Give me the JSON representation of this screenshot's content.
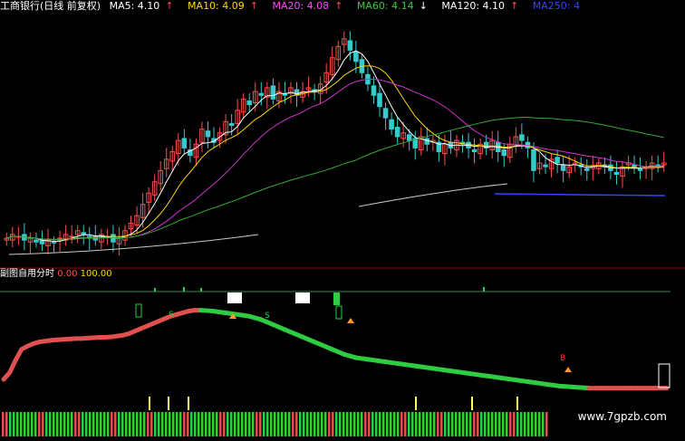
{
  "header": {
    "stock_label": "工商银行(日线 前复权)",
    "ma_items": [
      {
        "label": "MA5: 4.10",
        "arrow": "↑",
        "color": "#ffffff"
      },
      {
        "label": "MA10: 4.09",
        "arrow": "↑",
        "color": "#ffd700"
      },
      {
        "label": "MA20: 4.08",
        "arrow": "↑",
        "color": "#ff44ff"
      },
      {
        "label": "MA60: 4.14",
        "arrow": "↓",
        "color": "#33cc33"
      },
      {
        "label": "MA120: 4.10",
        "arrow": "↑",
        "color": "#ffffff"
      },
      {
        "label": "MA250: 4",
        "arrow": "",
        "color": "#3344ff"
      }
    ]
  },
  "indicator": {
    "name": "副图自用分时",
    "params": "0.00",
    "value": "100.00",
    "signal_labels": [
      "S",
      "S",
      "B"
    ]
  },
  "watermark": "www.7gpzb.com",
  "colors": {
    "up": "#ff4d4d",
    "down": "#33cccc",
    "green": "#2ecc40",
    "red": "#e05050"
  },
  "chart_data": {
    "type": "candlestick",
    "main": {
      "closes": [
        3.84,
        3.86,
        3.85,
        3.83,
        3.84,
        3.82,
        3.81,
        3.83,
        3.82,
        3.84,
        3.86,
        3.85,
        3.88,
        3.86,
        3.84,
        3.83,
        3.86,
        3.85,
        3.82,
        3.84,
        3.88,
        3.92,
        3.96,
        4.02,
        4.08,
        4.14,
        4.2,
        4.26,
        4.3,
        4.36,
        4.32,
        4.28,
        4.34,
        4.42,
        4.38,
        4.35,
        4.4,
        4.46,
        4.44,
        4.52,
        4.58,
        4.55,
        4.62,
        4.6,
        4.64,
        4.58,
        4.62,
        4.6,
        4.64,
        4.6,
        4.62,
        4.64,
        4.62,
        4.66,
        4.72,
        4.8,
        4.86,
        4.9,
        4.84,
        4.78,
        4.72,
        4.66,
        4.6,
        4.54,
        4.48,
        4.42,
        4.38,
        4.4,
        4.36,
        4.32,
        4.38,
        4.34,
        4.36,
        4.3,
        4.34,
        4.32,
        4.36,
        4.34,
        4.32,
        4.3,
        4.34,
        4.32,
        4.36,
        4.3,
        4.28,
        4.34,
        4.38,
        4.36,
        4.32,
        4.2,
        4.24,
        4.22,
        4.26,
        4.24,
        4.2,
        4.22,
        4.24,
        4.22,
        4.2,
        4.22,
        4.24,
        4.22,
        4.2,
        4.18,
        4.22,
        4.24,
        4.22,
        4.2,
        4.22,
        4.24,
        4.22,
        4.24
      ],
      "ylim": [
        3.72,
        5.02
      ]
    },
    "indicator": {
      "red_line": [
        24,
        40,
        70,
        96,
        104,
        110,
        114,
        116,
        118,
        119,
        120,
        121,
        122,
        122,
        123,
        124,
        125,
        125,
        126,
        128,
        130,
        134,
        140,
        146,
        152,
        158,
        164,
        170,
        176,
        180,
        184,
        188,
        190,
        190,
        189,
        188,
        186,
        184,
        182,
        180,
        178,
        176,
        172,
        168,
        162,
        156,
        150,
        144,
        138,
        132,
        126,
        120,
        114,
        108,
        102,
        96,
        90,
        84,
        80,
        76,
        74,
        72,
        70,
        68,
        66,
        64,
        62,
        60,
        58,
        56,
        54,
        52,
        50,
        48,
        46,
        44,
        42,
        40,
        38,
        36,
        34,
        32,
        30,
        28,
        26,
        24,
        22,
        20,
        18,
        16,
        14,
        12,
        10,
        8,
        7,
        6,
        5,
        4,
        3,
        3,
        3,
        3,
        3,
        3,
        3,
        3,
        3,
        3,
        3,
        3,
        3,
        3
      ],
      "ylim": [
        0,
        200
      ]
    }
  }
}
